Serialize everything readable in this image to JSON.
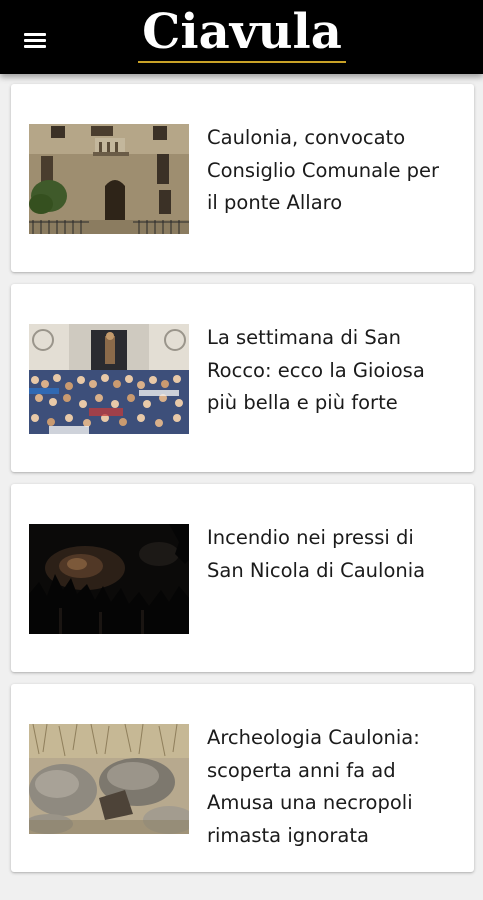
{
  "app": {
    "logo_text": "Ciavula",
    "menu_icon": "hamburger-menu-icon",
    "colors": {
      "appbar": "#000000",
      "logo_underline": "#c9a227",
      "background": "#f0f0f0",
      "card": "#ffffff",
      "headline": "#1b1b1b"
    }
  },
  "articles": [
    {
      "title": "Caulonia, convocato Consiglio Comunale per il ponte Allaro",
      "image": "town-hall-facade-photo"
    },
    {
      "title": "La settimana di San Rocco: ecco la Gioiosa più bella e più forte",
      "image": "san-rocco-procession-crowd-photo"
    },
    {
      "title": "Incendio nei pressi di San Nicola di Caulonia",
      "image": "night-wildfire-photo"
    },
    {
      "title": "Archeologia Caulonia: scoperta anni fa ad Amusa una necropoli rimasta ignorata",
      "image": "necropolis-stones-photo"
    }
  ]
}
